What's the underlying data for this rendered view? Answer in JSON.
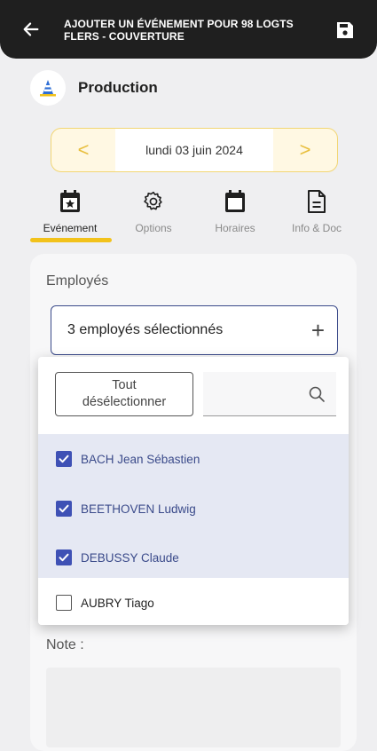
{
  "header": {
    "title": "AJOUTER UN ÉVÉNEMENT POUR 98 LOGTS FLERS - COUVERTURE",
    "back_icon": "arrow-left-icon",
    "save_icon": "floppy-disk-icon"
  },
  "site": {
    "name": "Production",
    "icon": "traffic-cone-icon"
  },
  "date_nav": {
    "prev": "<",
    "date": "lundi 03 juin 2024",
    "next": ">"
  },
  "tabs": [
    {
      "label": "Evénement",
      "icon": "calendar-star-icon",
      "active": true
    },
    {
      "label": "Options",
      "icon": "gear-icon",
      "active": false
    },
    {
      "label": "Horaires",
      "icon": "calendar-icon",
      "active": false
    },
    {
      "label": "Info & Doc",
      "icon": "document-icon",
      "active": false
    }
  ],
  "employees": {
    "label": "Employés",
    "selected_text": "3 employés sélectionnés",
    "add_symbol": "+"
  },
  "dropdown": {
    "deselect_line1": "Tout",
    "deselect_line2": "désélectionner",
    "search_placeholder": "",
    "items": [
      {
        "name": "BACH Jean Sébastien",
        "checked": true
      },
      {
        "name": "BEETHOVEN Ludwig",
        "checked": true
      },
      {
        "name": "DEBUSSY Claude",
        "checked": true
      },
      {
        "name": "AUBRY Tiago",
        "checked": false
      }
    ]
  },
  "note": {
    "label": "Note :"
  },
  "colors": {
    "accent_yellow": "#f2c21b",
    "accent_blue": "#3f51b5",
    "header_bg": "#1f1f1f"
  }
}
